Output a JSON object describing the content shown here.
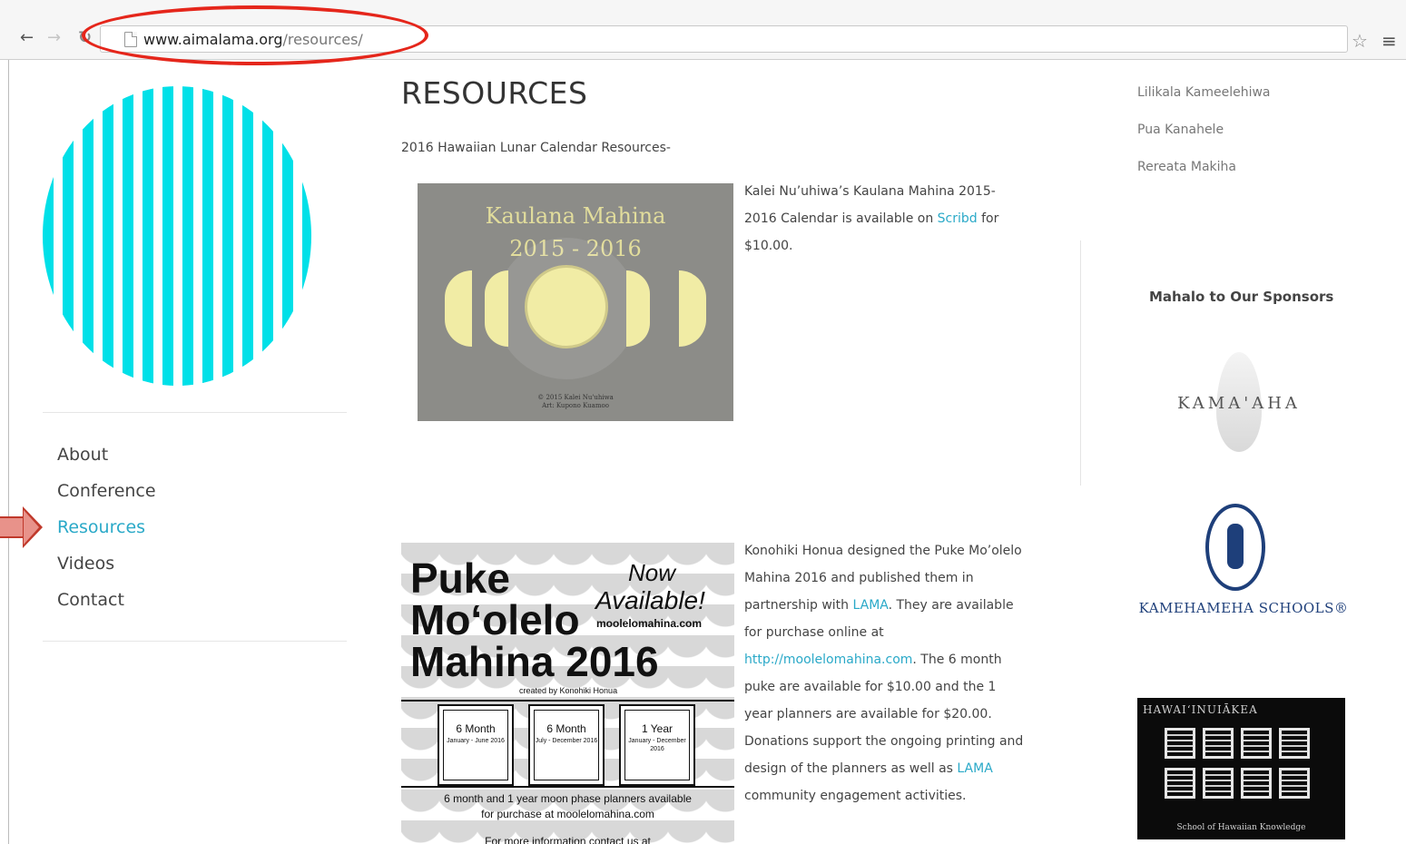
{
  "browser": {
    "url_host": "www.aimalama.org",
    "url_path": "/resources/",
    "back_icon": "back-arrow-icon",
    "forward_icon": "forward-arrow-icon",
    "reload_icon": "reload-icon",
    "bookmark_icon": "star-icon",
    "menu_icon": "hamburger-menu-icon",
    "annotation_color": "#e5261b"
  },
  "sidebar": {
    "nav": [
      {
        "label": "About",
        "active": false
      },
      {
        "label": "Conference",
        "active": false
      },
      {
        "label": "Resources",
        "active": true
      },
      {
        "label": "Videos",
        "active": false
      },
      {
        "label": "Contact",
        "active": false
      }
    ],
    "accent_color": "#2aa9c8",
    "logo_color": "#00e0e8"
  },
  "main": {
    "title": "RESOURCES",
    "subtitle": "2016 Hawaiian Lunar Calendar Resources-",
    "calendar": {
      "image_title_line1": "Kaulana Mahina",
      "image_title_line2": "2015 - 2016",
      "image_credit_line1": "© 2015 Kalei Nu'uhiwa",
      "image_credit_line2": "Art: Kupono Kuamoo",
      "desc_pre": "Kalei Nu’uhiwa’s Kaulana Mahina 2015-2016 Calendar is available on ",
      "desc_link": "Scribd",
      "desc_post": " for $10.00."
    },
    "puke": {
      "title_line1": "Puke",
      "title_line2": "Mo‘olelo",
      "title_line3": "Mahina 2016",
      "now": "Now",
      "available": "Available!",
      "site": "moolelomahina.com",
      "credit": "created by Konohiki Honua",
      "planners": [
        {
          "name": "6 Month",
          "dates": "January - June 2016"
        },
        {
          "name": "6 Month",
          "dates": "July - December 2016"
        },
        {
          "name": "1 Year",
          "dates": "January - December 2016"
        }
      ],
      "note_line1": "6 month and 1 year moon phase planners available",
      "note_line2": "for purchase at moolelomahina.com",
      "info": "For more information contact us at"
    },
    "puke_desc": {
      "p1": "Konohiki Honua designed the Puke Mo’olelo Mahina 2016 and published them in partnership with ",
      "link1": "LAMA",
      "p2": ".  They are available for purchase online at ",
      "link2": "http://moolelomahina.com",
      "p3": ".  The 6 month puke are available for $10.00 and the 1 year planners are available for $20.00.  Donations support the ongoing printing and design of the planners as well as ",
      "link3": "LAMA",
      "p4": " community engagement activities."
    }
  },
  "right_sidebar": {
    "people": [
      "Lilikala Kameelehiwa",
      "Pua Kanahele",
      "Rereata Makiha"
    ],
    "sponsors_title": "Mahalo to Our Sponsors",
    "sponsors": {
      "kamaaha": "KAMA'AHA",
      "kamehameha": "KAMEHAMEHA SCHOOLS®",
      "hawaiinuiakea_title": "HAWAIʻINUIĀKEA",
      "hawaiinuiakea_footer": "School of Hawaiian Knowledge"
    }
  }
}
